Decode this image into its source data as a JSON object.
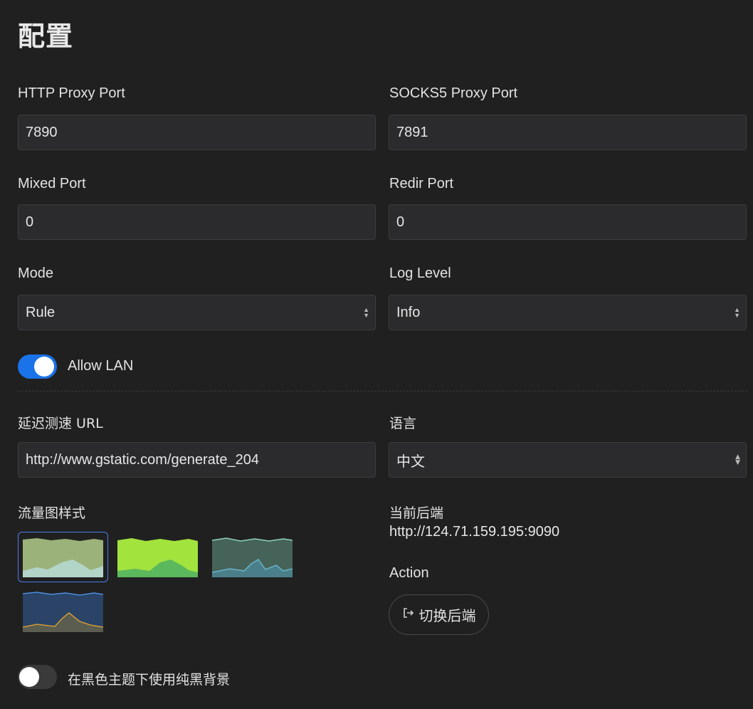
{
  "page": {
    "title": "配置"
  },
  "fields": {
    "http_port": {
      "label": "HTTP Proxy Port",
      "value": "7890"
    },
    "socks_port": {
      "label": "SOCKS5 Proxy Port",
      "value": "7891"
    },
    "mixed_port": {
      "label": "Mixed Port",
      "value": "0"
    },
    "redir_port": {
      "label": "Redir Port",
      "value": "0"
    },
    "mode": {
      "label": "Mode",
      "value": "Rule"
    },
    "log_level": {
      "label": "Log Level",
      "value": "Info"
    },
    "latency_url": {
      "label": "延迟测速 URL",
      "value": "http://www.gstatic.com/generate_204"
    },
    "language": {
      "label": "语言",
      "value": "中文"
    }
  },
  "allow_lan": {
    "label": "Allow LAN",
    "enabled": true
  },
  "traffic_chart_style": {
    "label": "流量图样式",
    "selected_index": 0,
    "options": [
      {
        "name": "style-1",
        "colors": [
          "#9bb27a",
          "#b3d5c8"
        ]
      },
      {
        "name": "style-2",
        "colors": [
          "#a3e33e",
          "#5cb85c"
        ]
      },
      {
        "name": "style-3",
        "colors": [
          "#456358",
          "#4a7f8a"
        ]
      },
      {
        "name": "style-4",
        "colors": [
          "#2a4366",
          "#5a5d50"
        ]
      }
    ]
  },
  "backend": {
    "label": "当前后端",
    "url": "http://124.71.159.195:9090",
    "action_label": "Action",
    "switch_button": "切换后端",
    "switch_icon": "logout-arrow-icon"
  },
  "pure_black": {
    "label": "在黑色主题下使用纯黑背景",
    "enabled": false
  },
  "theme": {
    "accent": "#1a73e8",
    "background": "#202020",
    "field_bg": "#2b2b2d"
  }
}
